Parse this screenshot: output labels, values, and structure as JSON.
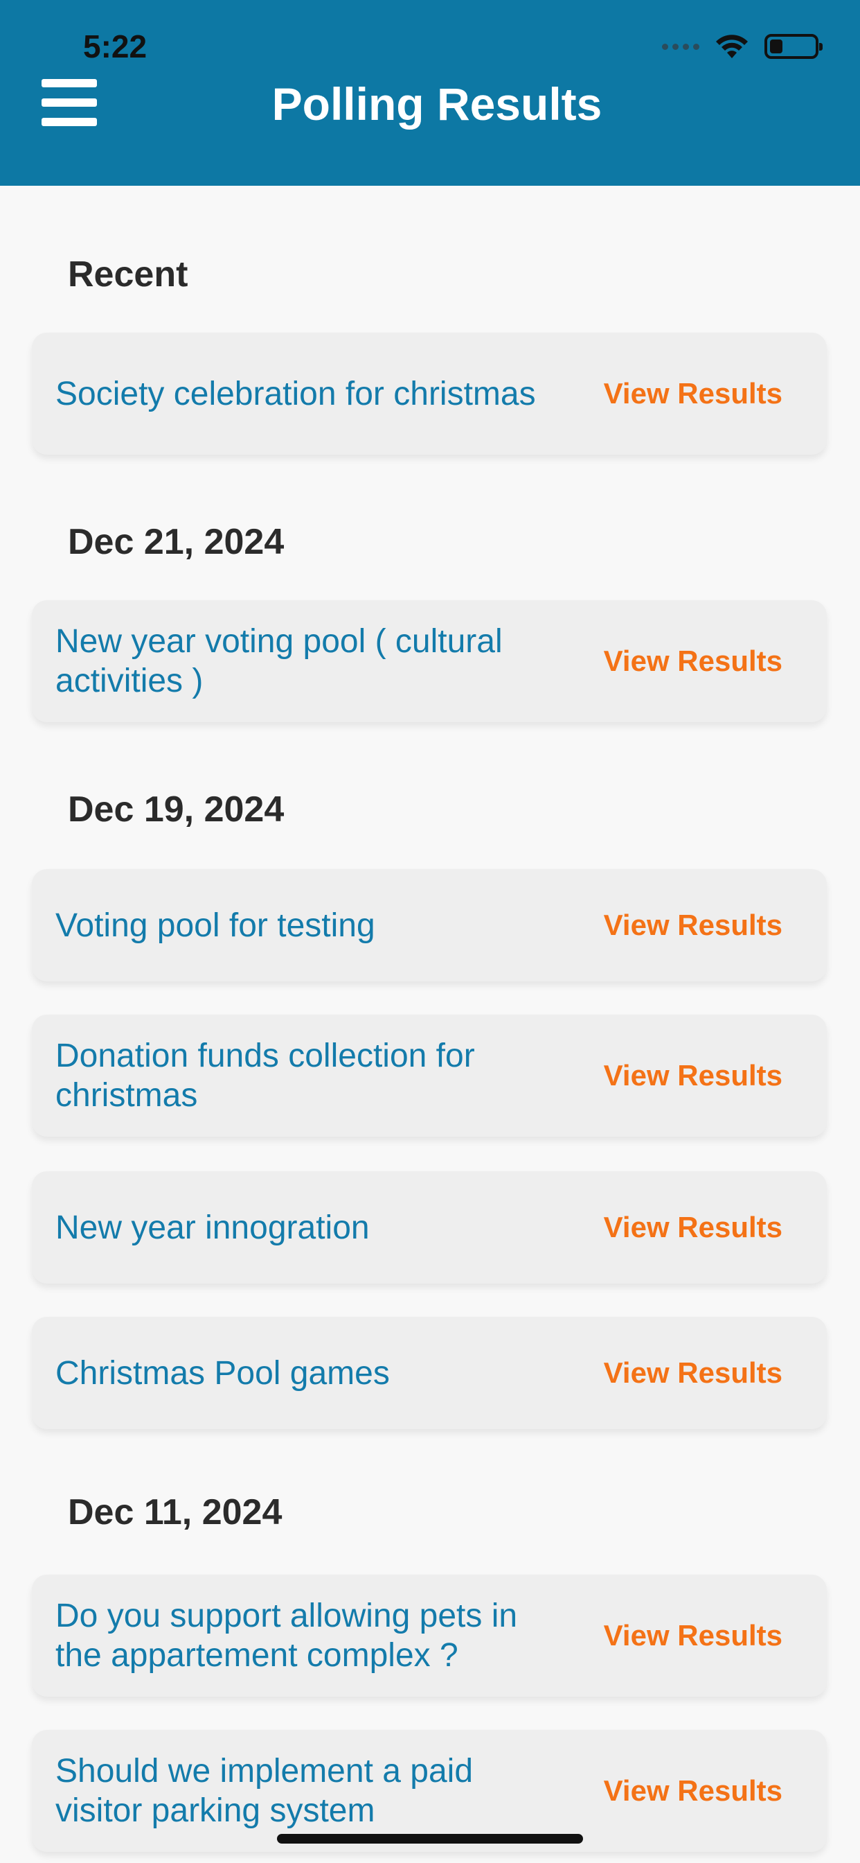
{
  "status_bar": {
    "time": "5:22"
  },
  "header": {
    "title": "Polling Results"
  },
  "sections": [
    {
      "label": "Recent",
      "polls": [
        {
          "title": "Society celebration for christmas",
          "action": "View Results"
        }
      ]
    },
    {
      "label": "Dec 21, 2024",
      "polls": [
        {
          "title": "New year voting pool ( cultural activities )",
          "action": "View Results"
        }
      ]
    },
    {
      "label": "Dec 19, 2024",
      "polls": [
        {
          "title": "Voting pool for testing",
          "action": "View Results"
        },
        {
          "title": "Donation funds collection for christmas",
          "action": "View Results"
        },
        {
          "title": "New year innogration",
          "action": "View Results"
        },
        {
          "title": "Christmas Pool games",
          "action": "View Results"
        }
      ]
    },
    {
      "label": "Dec 11, 2024",
      "polls": [
        {
          "title": "Do you support allowing pets in the appartement complex ?",
          "action": "View Results"
        },
        {
          "title": "Should we implement a paid visitor parking system",
          "action": "View Results"
        }
      ]
    }
  ],
  "colors": {
    "header": "#0d78a4",
    "poll_title": "#137bab",
    "action": "#f47216"
  }
}
